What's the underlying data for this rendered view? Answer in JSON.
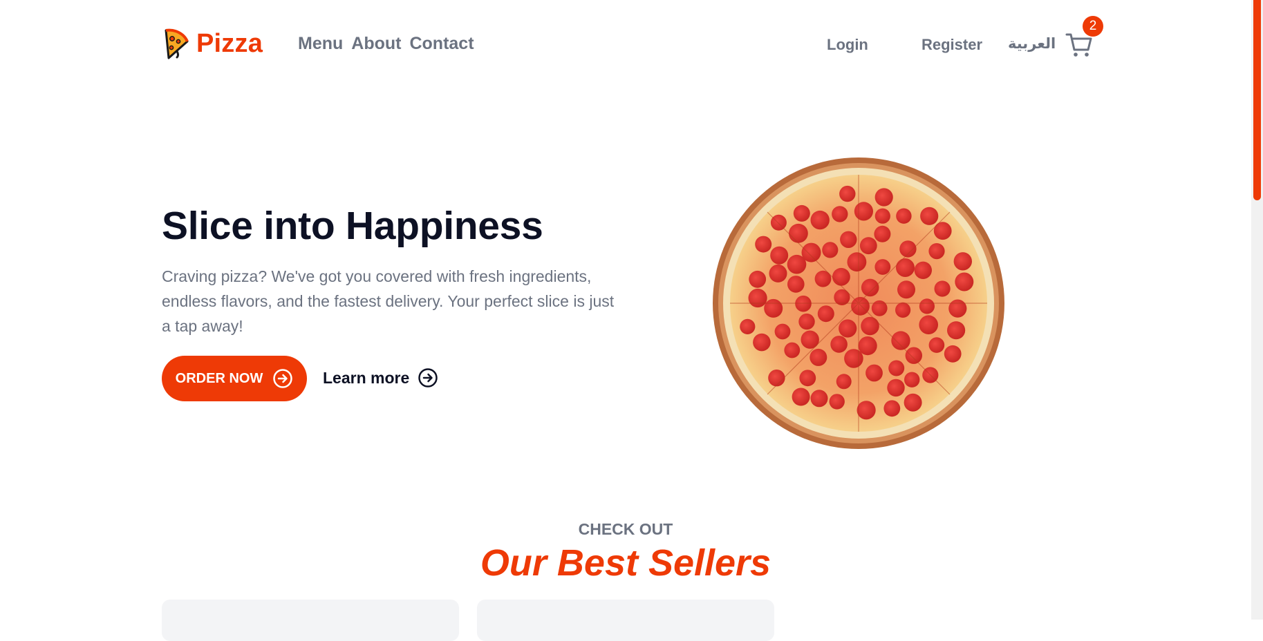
{
  "brand": {
    "name": "Pizza",
    "logo_icon": "pizza-slice-icon",
    "accent_color": "#ee3a06"
  },
  "nav": {
    "items": [
      {
        "label": "Menu"
      },
      {
        "label": "About"
      },
      {
        "label": "Contact"
      }
    ]
  },
  "auth": {
    "login_label": "Login",
    "register_label": "Register"
  },
  "language_label": "العربية",
  "cart": {
    "icon": "cart-icon",
    "count": "2"
  },
  "hero": {
    "title": "Slice into Happiness",
    "description": "Craving pizza? We've got you covered with fresh ingredients, endless flavors, and the fastest delivery. Your perfect slice is just a tap away!",
    "order_button_label": "ORDER NOW",
    "learn_more_label": "Learn more",
    "arrow_icon": "arrow-right-circle-icon",
    "image": "pepperoni-pizza-image"
  },
  "best_sellers": {
    "kicker": "CHECK OUT",
    "title": "Our Best Sellers"
  }
}
